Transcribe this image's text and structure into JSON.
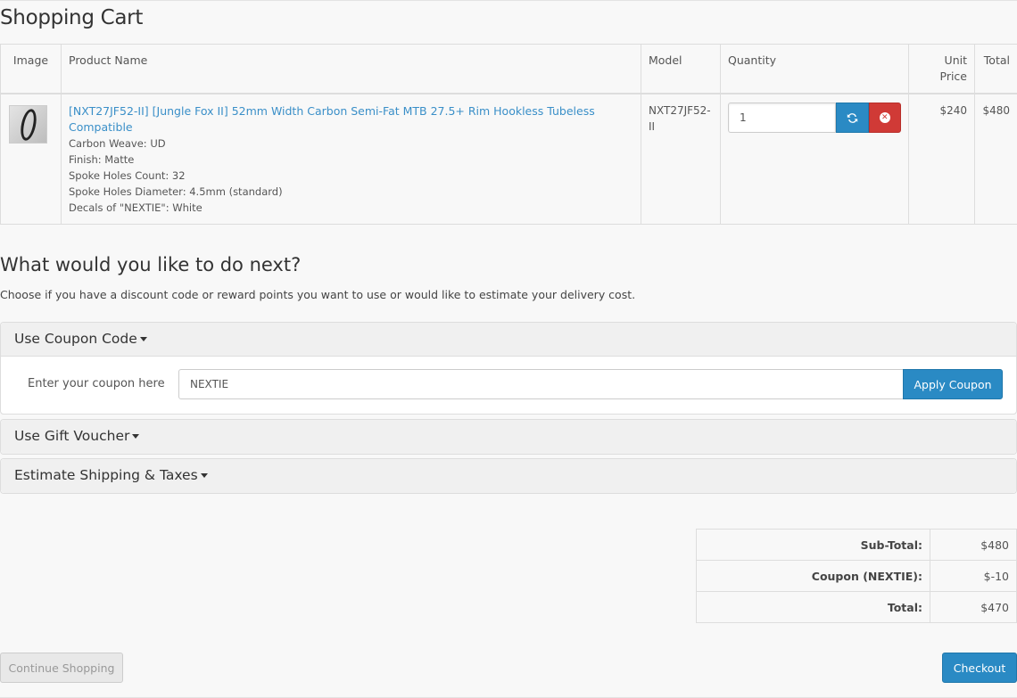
{
  "page": {
    "title": "Shopping Cart"
  },
  "cart": {
    "headers": {
      "image": "Image",
      "product": "Product Name",
      "model": "Model",
      "quantity": "Quantity",
      "unit_price": "Unit Price",
      "total": "Total"
    },
    "item": {
      "image_icon": "rim-thumbnail",
      "name": "[NXT27JF52-II] [Jungle Fox II] 52mm Width Carbon Semi-Fat MTB 27.5+ Rim Hookless Tubeless Compatible",
      "options": [
        "Carbon Weave: UD",
        "Finish: Matte",
        "Spoke Holes Count: 32",
        "Spoke Holes Diameter: 4.5mm (standard)",
        "Decals of \"NEXTIE\": White"
      ],
      "model": "NXT27JF52-II",
      "quantity": "1",
      "unit_price": "$240",
      "total": "$480"
    },
    "refresh_icon": "refresh-icon",
    "remove_icon": "remove-icon"
  },
  "next": {
    "title": "What would you like to do next?",
    "description": "Choose if you have a discount code or reward points you want to use or would like to estimate your delivery cost.",
    "coupon": {
      "heading": "Use Coupon Code",
      "label": "Enter your coupon here",
      "value": "NEXTIE",
      "button": "Apply Coupon"
    },
    "voucher": {
      "heading": "Use Gift Voucher"
    },
    "shipping": {
      "heading": "Estimate Shipping & Taxes"
    }
  },
  "totals": [
    {
      "label": "Sub-Total:",
      "value": "$480"
    },
    {
      "label": "Coupon (NEXTIE):",
      "value": "$-10"
    },
    {
      "label": "Total:",
      "value": "$470"
    }
  ],
  "buttons": {
    "continue": "Continue Shopping",
    "checkout": "Checkout"
  },
  "colors": {
    "accent": "#2a8ac4",
    "danger": "#d03a36",
    "link": "#3a8fc8"
  }
}
